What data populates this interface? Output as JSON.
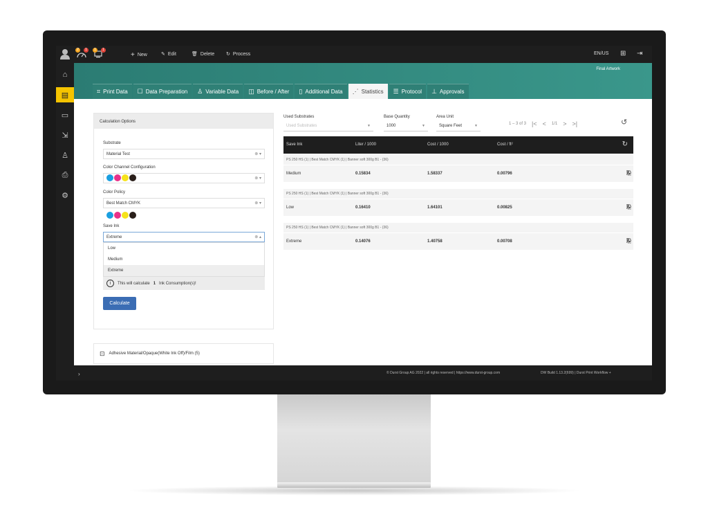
{
  "topbar": {
    "badges": [
      "2",
      "1",
      "1"
    ],
    "new_label": "New",
    "edit_label": "Edit",
    "delete_label": "Delete",
    "process_label": "Process",
    "locale": "EN/US"
  },
  "header": {
    "final_artwork": "Final Artwork",
    "tabs": [
      "Print Data",
      "Data Preparation",
      "Variable Data",
      "Before / After",
      "Additional Data",
      "Statistics",
      "Protocol",
      "Approvals"
    ]
  },
  "calc": {
    "title": "Calculation Options",
    "substrate_label": "Substrate",
    "substrate_value": "Material Test",
    "color_channel_label": "Color Channel Configuration",
    "color_policy_label": "Color Policy",
    "color_policy_value": "Best Match CMYK",
    "save_ink_label": "Save Ink",
    "save_ink_value": "Extreme",
    "save_ink_options": [
      "Low",
      "Medium",
      "Extreme"
    ],
    "info_prefix": "This will calculate",
    "info_count": "1",
    "info_suffix": "Ink Consumption(s)!",
    "calculate_label": "Calculate",
    "material_label": "Adhesive Material/Opaque(White Ink Off)/Film (5)",
    "ink_colors": [
      "#1a9fe0",
      "#e8328a",
      "#f6e21b",
      "#2a1f1a"
    ]
  },
  "filters": {
    "used_substrates_label": "Used Substrates",
    "used_substrates_placeholder": "Used Substrates",
    "base_quantity_label": "Base Quantity",
    "base_quantity_value": "1000",
    "area_unit_label": "Area Unit",
    "area_unit_value": "Square Feet",
    "range_text": "1 – 3 of 3",
    "page_text": "1/1"
  },
  "table": {
    "headers": [
      "Save Ink",
      "Liter / 1000",
      "Cost / 1000",
      "Cost / ft²"
    ],
    "rows": [
      {
        "sub": "PS 250 HS (1)  |  Best Match CMYK (1)  |  Banner soft 300g B1 - (36)",
        "save_ink": "Medium",
        "liter": "0.15834",
        "cost": "1.58337",
        "cost_ft": "0.00796"
      },
      {
        "sub": "PS 250 HS (1)  |  Best Match CMYK (1)  |  Banner soft 300g B1 - (36)",
        "save_ink": "Low",
        "liter": "0.16410",
        "cost": "1.64101",
        "cost_ft": "0.00825"
      },
      {
        "sub": "PS 250 HS (1)  |  Best Match CMYK (1)  |  Banner soft 300g B1 - (36)",
        "save_ink": "Extreme",
        "liter": "0.14076",
        "cost": "1.40758",
        "cost_ft": "0.00708"
      }
    ]
  },
  "footer": {
    "copyright": "© Durst Group AG 2022 | all rights reserved | https://www.durst-group.com",
    "build": "DW Build 1.13.2(699)  |  Durst Print Workflow +"
  },
  "colors": {
    "accent": "#3a978b",
    "highlight": "#f5c400",
    "button": "#3b6db4"
  }
}
